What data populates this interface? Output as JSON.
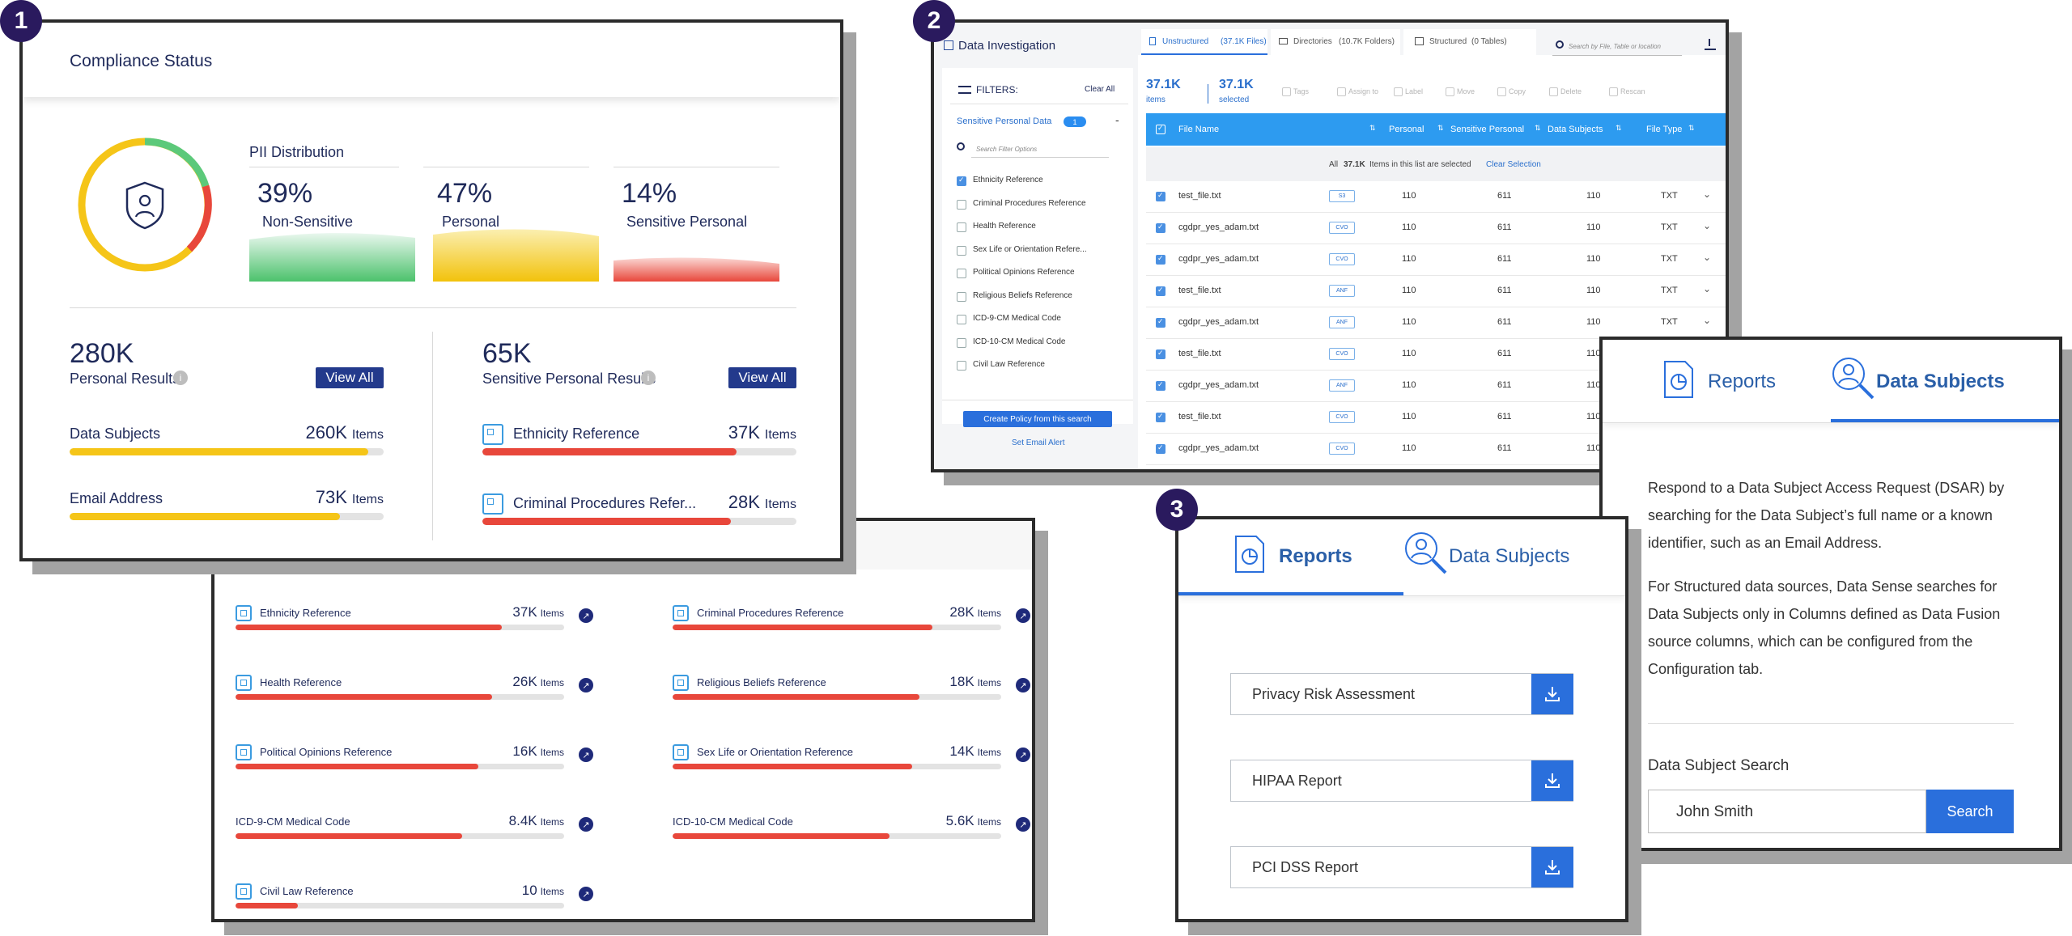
{
  "badges": [
    "1",
    "2",
    "3"
  ],
  "p1": {
    "title": "Compliance Status",
    "pii_title": "PII Distribution",
    "dist": [
      {
        "pct": "39%",
        "label": "Non-Sensitive",
        "color": "#5cc97a"
      },
      {
        "pct": "47%",
        "label": "Personal",
        "color": "#f5c518"
      },
      {
        "pct": "14%",
        "label": "Sensitive Personal",
        "color": "#e8473b"
      }
    ],
    "personal_count": "280K",
    "personal_label": "Personal Results",
    "view_all": "View All",
    "sensitive_count": "65K",
    "sensitive_label": "Sensitive Personal Results",
    "personal_rows": [
      {
        "name": "Data Subjects",
        "value": "260K",
        "unit": "Items",
        "fraction": 0.95
      },
      {
        "name": "Email Address",
        "value": "73K",
        "unit": "Items",
        "fraction": 0.86
      }
    ],
    "sensitive_rows": [
      {
        "name": "Ethnicity Reference",
        "value": "37K",
        "unit": "Items",
        "fraction": 0.81
      },
      {
        "name": "Criminal Procedures Refer...",
        "value": "28K",
        "unit": "Items",
        "fraction": 0.79
      }
    ]
  },
  "p1b": {
    "rows": [
      {
        "name": "Ethnicity Reference",
        "value": "37K",
        "unit": "Items",
        "fraction": 0.81,
        "icon": true
      },
      {
        "name": "Criminal Procedures Reference",
        "value": "28K",
        "unit": "Items",
        "fraction": 0.79,
        "icon": true
      },
      {
        "name": "Health Reference",
        "value": "26K",
        "unit": "Items",
        "fraction": 0.78,
        "icon": true
      },
      {
        "name": "Religious Beliefs Reference",
        "value": "18K",
        "unit": "Items",
        "fraction": 0.75,
        "icon": true
      },
      {
        "name": "Political Opinions Reference",
        "value": "16K",
        "unit": "Items",
        "fraction": 0.74,
        "icon": true
      },
      {
        "name": "Sex Life or Orientation Reference",
        "value": "14K",
        "unit": "Items",
        "fraction": 0.73,
        "icon": true
      },
      {
        "name": "ICD-9-CM Medical Code",
        "value": "8.4K",
        "unit": "Items",
        "fraction": 0.69,
        "icon": false
      },
      {
        "name": "ICD-10-CM Medical Code",
        "value": "5.6K",
        "unit": "Items",
        "fraction": 0.66,
        "icon": false
      },
      {
        "name": "Civil Law Reference",
        "value": "10",
        "unit": "Items",
        "fraction": 0.19,
        "icon": true
      }
    ]
  },
  "p2": {
    "title": "Data Investigation",
    "tabs": [
      {
        "label": "Unstructured",
        "count": "(37.1K Files)"
      },
      {
        "label": "Directories",
        "count": "(10.7K Folders)"
      },
      {
        "label": "Structured",
        "count": "(0 Tables)"
      }
    ],
    "search_placeholder": "Search by File, Table or location",
    "items_count": "37.1K",
    "items_label": "items",
    "selected_count": "37.1K",
    "selected_label": "selected",
    "actions": [
      "Tags",
      "Assign to",
      "Label",
      "Move",
      "Copy",
      "Delete",
      "Rescan"
    ],
    "filters_label": "FILTERS:",
    "clear_all": "Clear All",
    "filter_group": "Sensitive Personal Data",
    "filter_group_count": "1",
    "filter_search": "Search Filter Options",
    "filter_options": [
      {
        "label": "Ethnicity Reference",
        "checked": true
      },
      {
        "label": "Criminal Procedures Reference",
        "checked": false
      },
      {
        "label": "Health Reference",
        "checked": false
      },
      {
        "label": "Sex Life or Orientation Refere...",
        "checked": false
      },
      {
        "label": "Political Opinions Reference",
        "checked": false
      },
      {
        "label": "Religious Beliefs Reference",
        "checked": false
      },
      {
        "label": "ICD-9-CM Medical Code",
        "checked": false
      },
      {
        "label": "ICD-10-CM Medical Code",
        "checked": false
      },
      {
        "label": "Civil Law Reference",
        "checked": false
      }
    ],
    "create_policy": "Create Policy from this search",
    "set_alert": "Set Email Alert",
    "columns": [
      "File Name",
      "Personal",
      "Sensitive Personal",
      "Data Subjects",
      "File Type"
    ],
    "select_msg_pre": "All",
    "select_msg_count": "37.1K",
    "select_msg_post": "Items in this list are selected",
    "clear_selection": "Clear Selection",
    "rows": [
      {
        "file": "test_file.txt",
        "tag": "S3",
        "personal": "110",
        "sensitive": "611",
        "subjects": "110",
        "type": "TXT"
      },
      {
        "file": "cgdpr_yes_adam.txt",
        "tag": "CVO",
        "personal": "110",
        "sensitive": "611",
        "subjects": "110",
        "type": "TXT"
      },
      {
        "file": "cgdpr_yes_adam.txt",
        "tag": "CVO",
        "personal": "110",
        "sensitive": "611",
        "subjects": "110",
        "type": "TXT"
      },
      {
        "file": "test_file.txt",
        "tag": "ANF",
        "personal": "110",
        "sensitive": "611",
        "subjects": "110",
        "type": "TXT"
      },
      {
        "file": "cgdpr_yes_adam.txt",
        "tag": "ANF",
        "personal": "110",
        "sensitive": "611",
        "subjects": "110",
        "type": "TXT"
      },
      {
        "file": "test_file.txt",
        "tag": "CVO",
        "personal": "110",
        "sensitive": "611",
        "subjects": "110",
        "type": ""
      },
      {
        "file": "cgdpr_yes_adam.txt",
        "tag": "ANF",
        "personal": "110",
        "sensitive": "611",
        "subjects": "110",
        "type": ""
      },
      {
        "file": "test_file.txt",
        "tag": "CVO",
        "personal": "110",
        "sensitive": "611",
        "subjects": "110",
        "type": ""
      },
      {
        "file": "cgdpr_yes_adam.txt",
        "tag": "CVO",
        "personal": "110",
        "sensitive": "611",
        "subjects": "110",
        "type": ""
      }
    ]
  },
  "p3": {
    "tab_reports": "Reports",
    "tab_subjects": "Data Subjects",
    "reports": [
      "Privacy Risk Assessment",
      "HIPAA Report",
      "PCI DSS Report"
    ]
  },
  "p4": {
    "tab_reports": "Reports",
    "tab_subjects": "Data Subjects",
    "para1": "Respond to a Data Subject Access Request (DSAR) by searching for the Data Subject’s full name or a known identifier, such as an Email Address.",
    "para2": "For Structured data sources, Data Sense searches for Data Subjects only in Columns defined as Data Fusion source columns, which can be configured from the Configuration tab.",
    "search_label": "Data Subject Search",
    "search_value": "John Smith",
    "search_button": "Search"
  }
}
